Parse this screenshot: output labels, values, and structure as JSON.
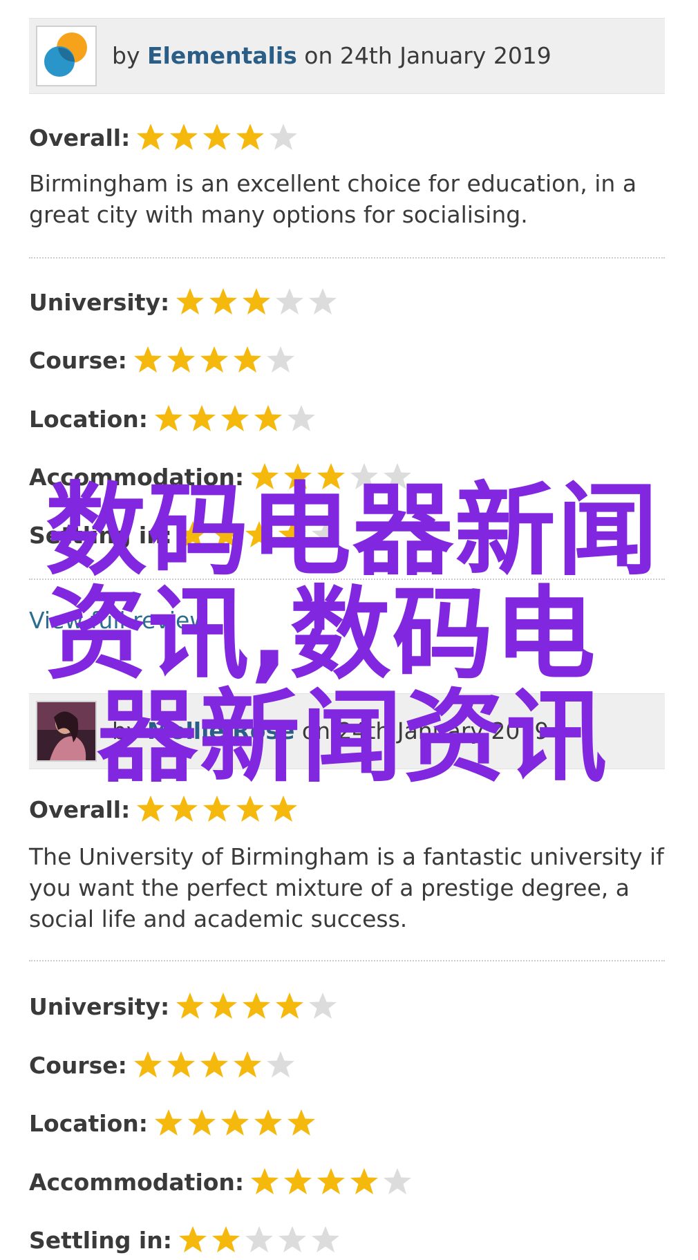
{
  "review1": {
    "by_prefix": "by",
    "author": "Elementalis",
    "date_text": "on 24th January 2019",
    "overall_label": "Overall:",
    "overall_stars": 4,
    "text": "Birmingham is an excellent choice for education, in a great city with many options for socialising.",
    "ratings": [
      {
        "label": "University:",
        "stars": 3
      },
      {
        "label": "Course:",
        "stars": 4
      },
      {
        "label": "Location:",
        "stars": 4
      },
      {
        "label": "Accommodation:",
        "stars": 3
      },
      {
        "label": "Settling in:",
        "stars": 4
      }
    ],
    "view_full_review": "View full review"
  },
  "review2": {
    "by_prefix": "by",
    "author": "Mollie Rose",
    "date_text": "on 24th January 2019",
    "overall_label": "Overall:",
    "overall_stars": 5,
    "text": "The University of Birmingham is a fantastic university if you want the perfect mixture of a prestige degree, a social life and academic success.",
    "ratings": [
      {
        "label": "University:",
        "stars": 4
      },
      {
        "label": "Course:",
        "stars": 4
      },
      {
        "label": "Location:",
        "stars": 5
      },
      {
        "label": "Accommodation:",
        "stars": 4
      },
      {
        "label": "Settling in:",
        "stars": 2
      }
    ]
  },
  "overlay": {
    "line1": "数码电器新闻",
    "line2": "资讯,数码电",
    "line3": "器新闻资讯"
  },
  "colors": {
    "star_on": "#f5b80d",
    "star_off": "#dcdcdc",
    "author_link": "#2b5e86",
    "overlay_text": "#8227e0"
  }
}
